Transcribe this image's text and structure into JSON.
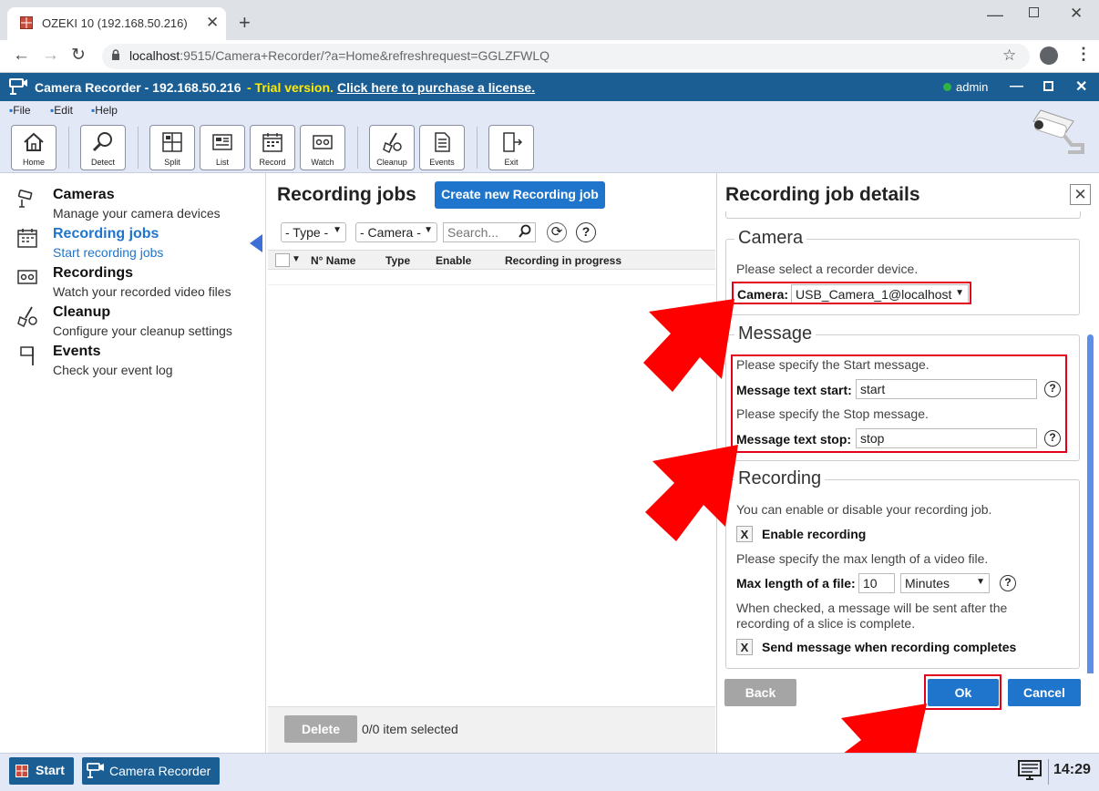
{
  "browser": {
    "tab_title": "OZEKI 10 (192.168.50.216)",
    "url_host": "localhost",
    "url_rest": ":9515/Camera+Recorder/?a=Home&refreshrequest=GGLZFWLQ"
  },
  "app": {
    "title": "Camera Recorder - 192.168.50.216",
    "trial": "- Trial version.",
    "purchase_link": "Click here to purchase a license.",
    "user": "admin"
  },
  "menu": [
    "File",
    "Edit",
    "Help"
  ],
  "toolbar": [
    "Home",
    "Detect",
    "Split",
    "List",
    "Record",
    "Watch",
    "Cleanup",
    "Events",
    "Exit"
  ],
  "nav": [
    {
      "title": "Cameras",
      "sub": "Manage your camera devices"
    },
    {
      "title": "Recording jobs",
      "sub": "Start recording jobs"
    },
    {
      "title": "Recordings",
      "sub": "Watch your recorded video files"
    },
    {
      "title": "Cleanup",
      "sub": "Configure your cleanup settings"
    },
    {
      "title": "Events",
      "sub": "Check your event log"
    }
  ],
  "jobs": {
    "heading": "Recording jobs",
    "create_button": "Create new Recording job",
    "type_filter": "- Type -",
    "camera_filter": "- Camera -",
    "search_placeholder": "Search...",
    "columns": [
      "N° Name",
      "Type",
      "Enable",
      "Recording in progress"
    ],
    "delete_button": "Delete",
    "status": "0/0 item selected"
  },
  "details": {
    "heading": "Recording job details",
    "camera_legend": "Camera",
    "camera_hint": "Please select a recorder device.",
    "camera_label": "Camera:",
    "camera_value": "USB_Camera_1@localhost",
    "message_legend": "Message",
    "start_hint": "Please specify the Start message.",
    "start_label": "Message text start:",
    "start_value": "start",
    "stop_hint": "Please specify the Stop message.",
    "stop_label": "Message text stop:",
    "stop_value": "stop",
    "recording_legend": "Recording",
    "recording_hint": "You can enable or disable your recording job.",
    "enable_label": "Enable recording",
    "maxlen_hint": "Please specify the max length of a video file.",
    "maxlen_label": "Max length of a file:",
    "maxlen_value": "10",
    "maxlen_unit": "Minutes",
    "slice_hint": "When checked, a message will be sent after the recording of a slice is complete.",
    "send_label": "Send message when recording completes",
    "back_button": "Back",
    "ok_button": "Ok",
    "cancel_button": "Cancel",
    "check_mark": "X",
    "help_mark": "?"
  },
  "taskbar": {
    "start": "Start",
    "app": "Camera Recorder",
    "clock": "14:29"
  },
  "colors": {
    "title_bar": "#1b5e94",
    "accent": "#1f75cc",
    "highlight": "#e2001a",
    "online": "#2fb344"
  }
}
